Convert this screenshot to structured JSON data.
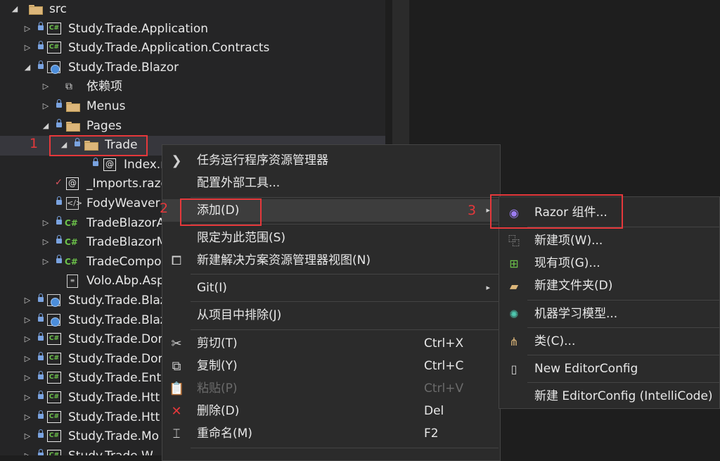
{
  "tree": {
    "rows": [
      {
        "label": "src",
        "icon": "folder-icon"
      },
      {
        "label": "Study.Trade.Application",
        "icon": "csharp-project-icon"
      },
      {
        "label": "Study.Trade.Application.Contracts",
        "icon": "csharp-project-icon"
      },
      {
        "label": "Study.Trade.Blazor",
        "icon": "web-project-icon"
      },
      {
        "label": "依赖项",
        "icon": "dependencies-icon"
      },
      {
        "label": "Menus",
        "icon": "folder-icon"
      },
      {
        "label": "Pages",
        "icon": "folder-icon"
      },
      {
        "label": "Trade",
        "icon": "folder-icon"
      },
      {
        "label": "Index.r",
        "icon": "razor-file-icon"
      },
      {
        "label": "_Imports.razo",
        "icon": "razor-file-icon"
      },
      {
        "label": "FodyWeaver",
        "icon": "xml-file-icon"
      },
      {
        "label": "TradeBlazorA",
        "icon": "csharp-file-icon"
      },
      {
        "label": "TradeBlazorM",
        "icon": "csharp-file-icon"
      },
      {
        "label": "TradeCompo",
        "icon": "csharp-file-icon"
      },
      {
        "label": "Volo.Abp.Asp",
        "icon": "file-icon"
      },
      {
        "label": "Study.Trade.Blaz",
        "icon": "web-project-icon"
      },
      {
        "label": "Study.Trade.Blaz",
        "icon": "web-project-icon"
      },
      {
        "label": "Study.Trade.Dor",
        "icon": "csharp-project-icon"
      },
      {
        "label": "Study.Trade.Dor",
        "icon": "csharp-project-icon"
      },
      {
        "label": "Study.Trade.Ent",
        "icon": "csharp-project-icon"
      },
      {
        "label": "Study.Trade.Htt",
        "icon": "csharp-project-icon"
      },
      {
        "label": "Study.Trade.Htt",
        "icon": "csharp-project-icon"
      },
      {
        "label": "Study.Trade.Mo",
        "icon": "csharp-project-icon"
      },
      {
        "label": "Study.Trade.W",
        "icon": "csharp-project-icon"
      }
    ]
  },
  "annotations": {
    "one": "1",
    "two": "2",
    "three": "3"
  },
  "context_menu": {
    "items": [
      {
        "label": "任务运行程序资源管理器",
        "icon": "task-runner-icon"
      },
      {
        "label": "配置外部工具..."
      },
      {
        "label": "添加(D)",
        "submenu": "▸"
      },
      {
        "label": "限定为此范围(S)"
      },
      {
        "label": "新建解决方案资源管理器视图(N)",
        "icon": "new-view-icon"
      },
      {
        "label": "Git(I)",
        "submenu": "▸"
      },
      {
        "label": "从项目中排除(J)"
      },
      {
        "label": "剪切(T)",
        "shortcut": "Ctrl+X",
        "icon": "scissors-icon"
      },
      {
        "label": "复制(Y)",
        "shortcut": "Ctrl+C",
        "icon": "copy-icon"
      },
      {
        "label": "粘贴(P)",
        "shortcut": "Ctrl+V",
        "icon": "paste-icon"
      },
      {
        "label": "删除(D)",
        "shortcut": "Del",
        "icon": "delete-icon"
      },
      {
        "label": "重命名(M)",
        "shortcut": "F2",
        "icon": "rename-icon"
      }
    ]
  },
  "submenu": {
    "items": [
      {
        "label": "Razor 组件...",
        "icon": "razor-component-icon"
      },
      {
        "label": "新建项(W)...",
        "icon": "new-item-icon"
      },
      {
        "label": "现有项(G)...",
        "icon": "existing-item-icon"
      },
      {
        "label": "新建文件夹(D)",
        "icon": "new-folder-icon"
      },
      {
        "label": "机器学习模型...",
        "icon": "ml-model-icon"
      },
      {
        "label": "类(C)...",
        "icon": "class-icon"
      },
      {
        "label": "New EditorConfig",
        "icon": "editorconfig-icon"
      },
      {
        "label": "新建 EditorConfig (IntelliCode)"
      }
    ]
  }
}
